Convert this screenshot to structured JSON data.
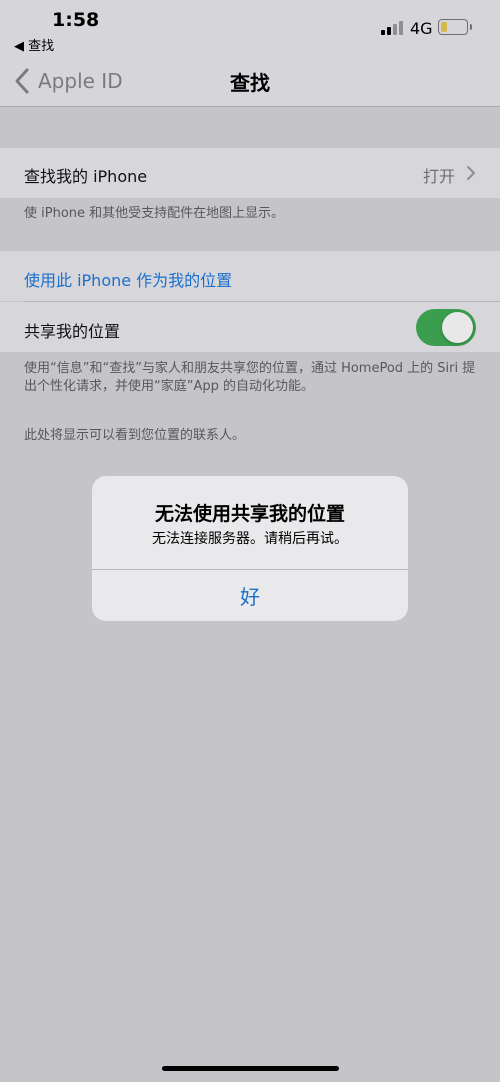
{
  "status_bar": {
    "time": "1:58",
    "back_app": "◀ 查找",
    "carrier": "4G",
    "battery_level": 0.25,
    "battery_color": "#d6b84a",
    "signal_bars_active": 2,
    "signal_bars_total": 4
  },
  "nav": {
    "back_label": "Apple ID",
    "title": "查找"
  },
  "find_my_iphone": {
    "label": "查找我的 iPhone",
    "value": "打开",
    "footnote": "使 iPhone 和其他受支持配件在地图上显示。"
  },
  "location": {
    "use_this_iphone": "使用此 iPhone 作为我的位置",
    "share_label": "共享我的位置",
    "share_enabled": true,
    "share_footnote": "使用“信息”和“查找”与家人和朋友共享您的位置，通过 HomePod 上的 Siri 提出个性化请求，并使用“家庭”App 的自动化功能。",
    "contacts_note": "此处将显示可以看到您位置的联系人。"
  },
  "alert": {
    "title": "无法使用共享我的位置",
    "message": "无法连接服务器。请稍后再试。",
    "button": "好"
  },
  "colors": {
    "accent": "#1b6fcc",
    "toggle_on": "#3a9e4e"
  },
  "icons": [
    "chevron-left-icon",
    "chevron-right-icon",
    "signal-icon",
    "battery-icon"
  ]
}
